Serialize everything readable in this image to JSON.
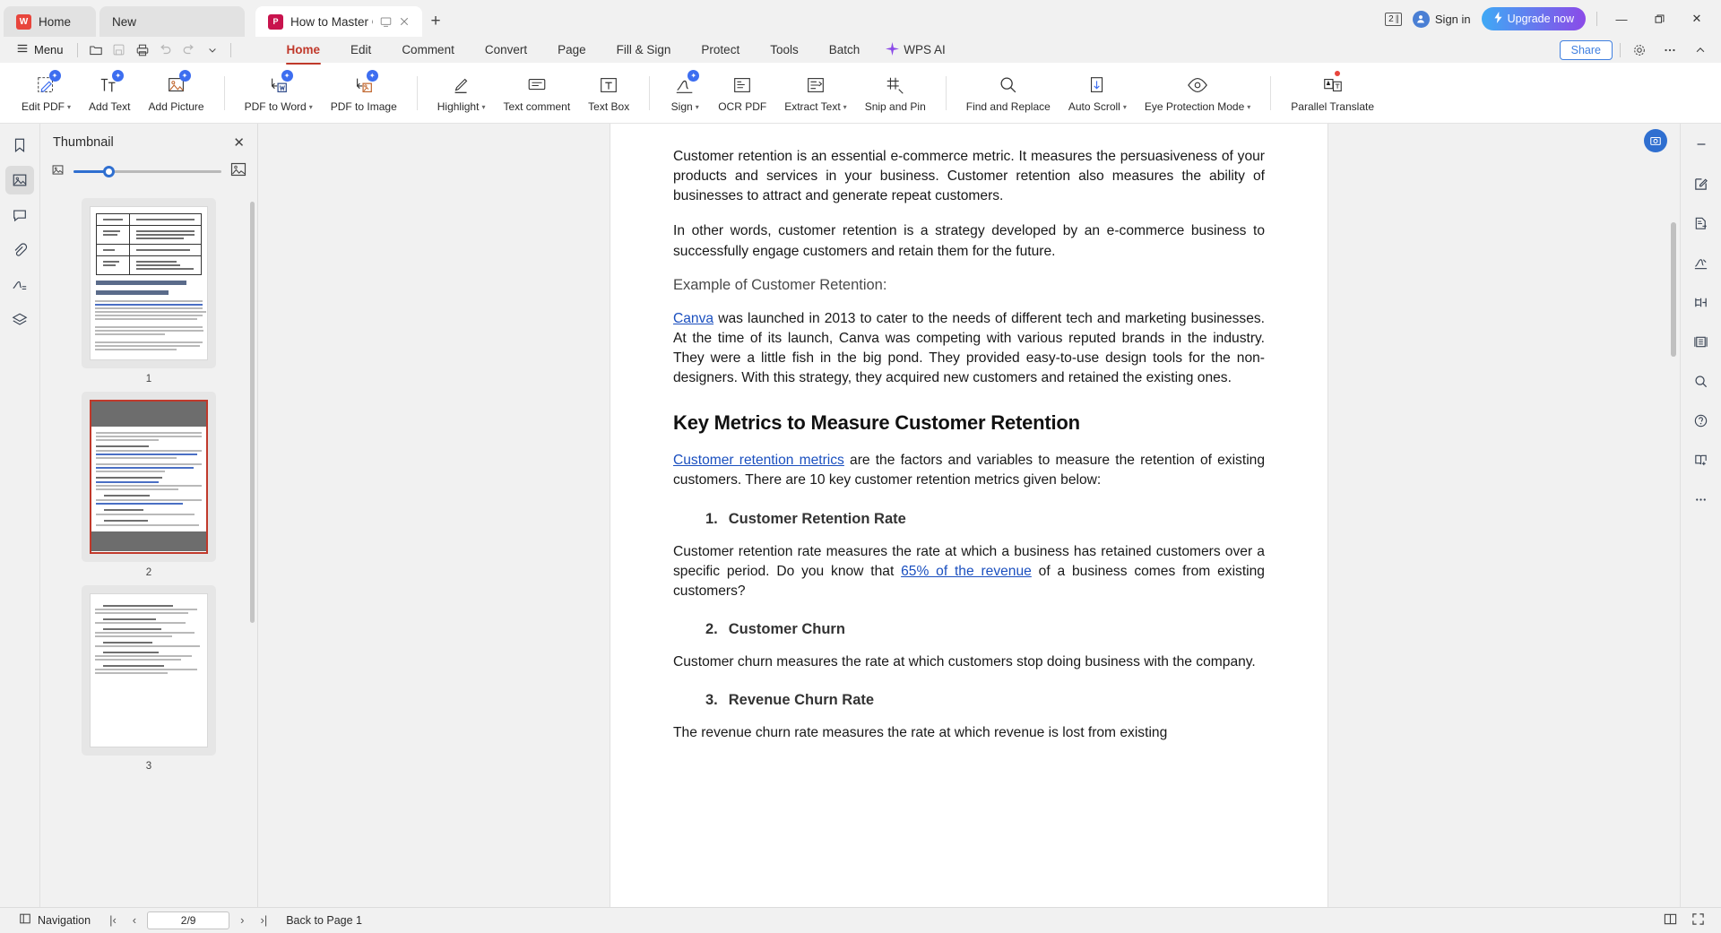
{
  "tabs": [
    {
      "label": "Home",
      "icon": "wps-logo-icon",
      "type": "home"
    },
    {
      "label": "New",
      "icon": "none",
      "type": "new"
    },
    {
      "label": "How to Master Customer Rete",
      "icon": "pdf-file-icon",
      "type": "document",
      "active": true
    }
  ],
  "titlebar": {
    "new_tab_plus": "+",
    "doc_count_badge": "2",
    "sign_in": "Sign in",
    "upgrade": "Upgrade now",
    "minimize": "—",
    "maximize": "❐",
    "close": "✕"
  },
  "menubar": {
    "menu_label": "Menu",
    "quick_access": [
      "open-icon",
      "save-icon",
      "print-icon",
      "undo-icon",
      "redo-icon",
      "customize-caret-icon"
    ],
    "tabs": [
      {
        "label": "Home",
        "selected": true
      },
      {
        "label": "Edit",
        "selected": false
      },
      {
        "label": "Comment",
        "selected": false
      },
      {
        "label": "Convert",
        "selected": false
      },
      {
        "label": "Page",
        "selected": false
      },
      {
        "label": "Fill & Sign",
        "selected": false
      },
      {
        "label": "Protect",
        "selected": false
      },
      {
        "label": "Tools",
        "selected": false
      },
      {
        "label": "Batch",
        "selected": false
      }
    ],
    "wps_ai": "WPS AI",
    "share": "Share",
    "settings_icon": "gear-icon",
    "more_icon": "more-horizontal-icon",
    "collapse_icon": "chevron-up-icon"
  },
  "toolbar": {
    "groups": [
      {
        "items": [
          {
            "label": "Edit PDF",
            "icon": "edit-pdf-icon",
            "caret": true,
            "ai": true
          },
          {
            "label": "Add Text",
            "icon": "add-text-icon",
            "caret": false,
            "ai": true
          },
          {
            "label": "Add Picture",
            "icon": "add-picture-icon",
            "caret": false,
            "ai": true
          }
        ]
      },
      {
        "items": [
          {
            "label": "PDF to Word",
            "icon": "pdf-to-word-icon",
            "caret": true,
            "ai": true
          },
          {
            "label": "PDF to Image",
            "icon": "pdf-to-image-icon",
            "caret": false,
            "ai": true
          }
        ]
      },
      {
        "items": [
          {
            "label": "Highlight",
            "icon": "highlight-icon",
            "caret": true,
            "ai": false
          },
          {
            "label": "Text comment",
            "icon": "text-comment-icon",
            "caret": false,
            "ai": false
          },
          {
            "label": "Text Box",
            "icon": "text-box-icon",
            "caret": false,
            "ai": false
          }
        ]
      },
      {
        "items": [
          {
            "label": "Sign",
            "icon": "sign-icon",
            "caret": true,
            "ai": true
          },
          {
            "label": "OCR PDF",
            "icon": "ocr-pdf-icon",
            "caret": false,
            "ai": false
          },
          {
            "label": "Extract Text",
            "icon": "extract-text-icon",
            "caret": true,
            "ai": false
          },
          {
            "label": "Snip and Pin",
            "icon": "snip-and-pin-icon",
            "caret": false,
            "ai": false
          }
        ]
      },
      {
        "items": [
          {
            "label": "Find and Replace",
            "icon": "search-icon",
            "caret": false,
            "ai": false
          },
          {
            "label": "Auto Scroll",
            "icon": "auto-scroll-icon",
            "caret": true,
            "ai": false
          },
          {
            "label": "Eye Protection Mode",
            "icon": "eye-icon",
            "caret": true,
            "ai": false
          }
        ]
      },
      {
        "items": [
          {
            "label": "Parallel Translate",
            "icon": "parallel-translate-icon",
            "caret": false,
            "ai": false,
            "dot": true
          }
        ]
      }
    ]
  },
  "left_rail": [
    {
      "name": "bookmark-icon",
      "active": false
    },
    {
      "name": "thumbnail-icon",
      "active": true
    },
    {
      "name": "comment-icon",
      "active": false
    },
    {
      "name": "attachment-icon",
      "active": false
    },
    {
      "name": "signature-icon",
      "active": false
    },
    {
      "name": "layers-icon",
      "active": false
    }
  ],
  "thumbnail_panel": {
    "title": "Thumbnail",
    "close": "✕",
    "zoom_out_icon": "small-image-icon",
    "zoom_in_icon": "large-image-icon",
    "pages": [
      {
        "number": "1",
        "selected": false
      },
      {
        "number": "2",
        "selected": true
      },
      {
        "number": "3",
        "selected": false
      }
    ]
  },
  "document": {
    "paragraphs": [
      {
        "type": "p",
        "text": "Customer retention is an essential e-commerce metric. It measures the persuasiveness of your products and services in your business. Customer retention also measures the ability of businesses to attract and generate repeat customers."
      },
      {
        "type": "p",
        "text": "In other words, customer retention is a strategy developed by an e-commerce business to successfully engage customers and retain them for the future."
      },
      {
        "type": "subhead",
        "text": "Example of Customer Retention:"
      },
      {
        "type": "p_link_lead",
        "link": "Canva",
        "text": " was launched in 2013 to cater to the needs of different tech and marketing businesses. At the time of its launch, Canva was competing with various reputed brands in the industry. They were a little fish in the big pond. They provided easy-to-use design tools for the non-designers. With this strategy, they acquired new customers and retained the existing ones."
      },
      {
        "type": "h2",
        "text": "Key Metrics to Measure Customer Retention"
      },
      {
        "type": "p_link_lead2",
        "link": "Customer retention metrics",
        "text": " are the factors and variables to measure the retention of existing customers.  There are 10 key customer retention metrics given below:"
      },
      {
        "type": "numhead",
        "num": "1.",
        "text": "Customer Retention Rate"
      },
      {
        "type": "p_inline_link",
        "pre": "Customer retention rate measures the rate at which a business has retained customers over a specific period. Do you know that ",
        "link": "65% of the revenue",
        "post": " of a business comes from existing customers?"
      },
      {
        "type": "numhead",
        "num": "2.",
        "text": "Customer Churn"
      },
      {
        "type": "p",
        "text": "Customer churn measures the rate at which customers stop doing business with the company."
      },
      {
        "type": "numhead",
        "num": "3.",
        "text": "Revenue Churn Rate"
      },
      {
        "type": "p",
        "text": "The revenue churn rate measures the rate at which revenue is lost from existing"
      }
    ]
  },
  "right_rail": [
    {
      "name": "collapse-dash-icon"
    },
    {
      "name": "edit-square-icon"
    },
    {
      "name": "export-document-icon"
    },
    {
      "name": "signature-pen-icon"
    },
    {
      "name": "page-layout-icon"
    },
    {
      "name": "scroll-mode-icon"
    },
    {
      "name": "search-icon"
    },
    {
      "name": "help-icon"
    },
    {
      "name": "read-mode-icon"
    },
    {
      "name": "more-options-icon"
    }
  ],
  "viewer": {
    "float_action_icon": "screenshot-icon"
  },
  "statusbar": {
    "navigation": "Navigation",
    "first_page": "|‹",
    "prev_page": "‹",
    "page_value": "2/9",
    "next_page": "›",
    "last_page": "›|",
    "back_to_page": "Back to Page 1",
    "view_mode_icon": "page-view-icon",
    "fullscreen_icon": "fullscreen-icon"
  },
  "colors": {
    "accent_red": "#c0392b",
    "link_blue": "#1a4fbf",
    "primary_blue": "#2f6fd0",
    "chrome_bg": "#f1f1f1"
  }
}
